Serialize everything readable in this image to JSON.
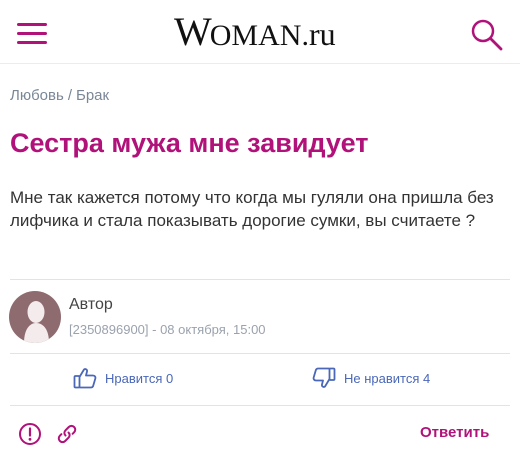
{
  "header": {
    "logo_first": "W",
    "logo_caps": "OMAN",
    "logo_dot": ".",
    "logo_tld": "ru"
  },
  "breadcrumb": {
    "items": [
      "Любовь",
      "Брак"
    ],
    "separator": "/"
  },
  "post": {
    "title": "Сестра мужа мне завидует",
    "body": "Мне так кажется потому что когда мы гуляли она пришла без лифчика и стала показывать дорогие сумки, вы считаете ?"
  },
  "author": {
    "name": "Автор",
    "meta": "[2350896900] - 08 октября, 15:00"
  },
  "votes": {
    "like_label": "Нравится 0",
    "dislike_label": "Не нравится 4"
  },
  "actions": {
    "reply_label": "Ответить"
  },
  "colors": {
    "accent": "#b0127a",
    "link_blue": "#4a67b8",
    "muted": "#7a8797"
  },
  "icons": [
    "menu-icon",
    "search-icon",
    "avatar-silhouette-icon",
    "thumbs-up-icon",
    "thumbs-down-icon",
    "report-icon",
    "link-icon"
  ]
}
